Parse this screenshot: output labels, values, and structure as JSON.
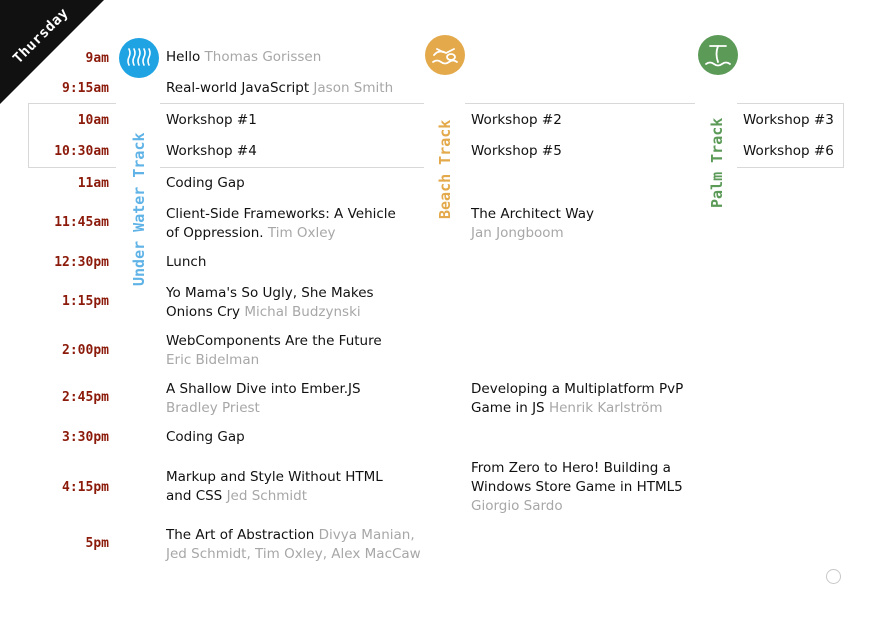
{
  "day": "Thursday",
  "tracks": {
    "underwater": {
      "label": "Under Water Track",
      "icon": "water-icon",
      "color": "#1fa3e2"
    },
    "beach": {
      "label": "Beach Track",
      "icon": "beach-icon",
      "color": "#e3a94a"
    },
    "palm": {
      "label": "Palm Track",
      "icon": "palm-icon",
      "color": "#5c9a58"
    }
  },
  "slots": {
    "t1": {
      "time": "9am",
      "title": "Hello",
      "speaker": "Thomas Gorissen"
    },
    "t2": {
      "time": "9:15am",
      "title": "Real-world JavaScript",
      "speaker": "Jason Smith"
    },
    "t3": {
      "time": "10am",
      "uw": "Workshop #1",
      "beach": "Workshop #2",
      "palm": "Workshop #3"
    },
    "t4": {
      "time": "10:30am",
      "uw": "Workshop #4",
      "beach": "Workshop #5",
      "palm": "Workshop #6"
    },
    "t5": {
      "time": "11am",
      "title": "Coding Gap"
    },
    "t6": {
      "time": "11:45am",
      "uw_title_1": "Client-Side Frameworks: A Vehicle",
      "uw_title_2": "of Oppression.",
      "uw_speaker": "Tim Oxley",
      "beach_title": "The Architect Way",
      "beach_speaker": "Jan Jongboom"
    },
    "t7": {
      "time": "12:30pm",
      "title": "Lunch"
    },
    "t8": {
      "time": "1:15pm",
      "title_1": "Yo Mama's So Ugly, She Makes",
      "title_2": "Onions Cry",
      "speaker": "Michal Budzynski"
    },
    "t9": {
      "time": "2:00pm",
      "title": "WebComponents Are the Future",
      "speaker": "Eric Bidelman"
    },
    "t10": {
      "time": "2:45pm",
      "uw_title": "A Shallow Dive into Ember.JS",
      "uw_speaker": "Bradley Priest",
      "beach_title_1": "Developing a Multiplatform PvP",
      "beach_title_2": "Game in JS",
      "beach_speaker": "Henrik Karlström"
    },
    "t11": {
      "time": "3:30pm",
      "title": "Coding Gap"
    },
    "t12": {
      "time": "4:15pm",
      "uw_title_1": "Markup and Style Without HTML",
      "uw_title_2": "and CSS",
      "uw_speaker": "Jed Schmidt",
      "beach_title_1": "From Zero to Hero! Building a",
      "beach_title_2": "Windows Store Game in HTML5",
      "beach_speaker": "Giorgio Sardo"
    },
    "t13": {
      "time": "5pm",
      "title": "The Art of Abstraction",
      "speaker_1": "Divya Manian,",
      "speaker_2": "Jed Schmidt, Tim Oxley, Alex MacCaw"
    }
  }
}
